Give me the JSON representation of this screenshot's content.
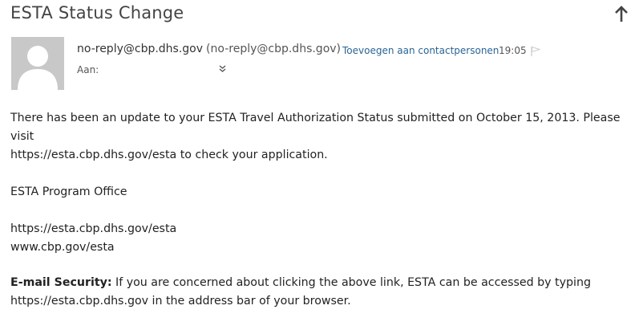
{
  "email": {
    "subject": "ESTA Status Change",
    "sender_address": "no-reply@cbp.dhs.gov",
    "sender_display": "(no-reply@cbp.dhs.gov)",
    "add_to_contacts": "Toevoegen aan contactpersonen",
    "time": "19:05",
    "to_label": "Aan:",
    "body": {
      "paragraph1_line1": "There has been an update to your ESTA Travel Authorization Status submitted on October 15, 2013. Please visit",
      "paragraph1_line2": "https://esta.cbp.dhs.gov/esta to check your application.",
      "signature": "ESTA Program Office",
      "link1": "https://esta.cbp.dhs.gov/esta",
      "link2": "www.cbp.gov/esta",
      "security_label": "E-mail Security:",
      "security_line1": " If you are concerned about clicking the above link, ESTA can be accessed by typing",
      "security_line2": "https://esta.cbp.dhs.gov in the address bar of your browser."
    }
  },
  "icons": {
    "up": "up-arrow-icon",
    "avatar": "person-avatar-icon",
    "flag": "flag-icon",
    "expand": "double-chevron-down-icon"
  },
  "colors": {
    "link": "#2a6496",
    "avatar_bg": "#c8c8c8",
    "avatar_fg": "#ffffff"
  }
}
